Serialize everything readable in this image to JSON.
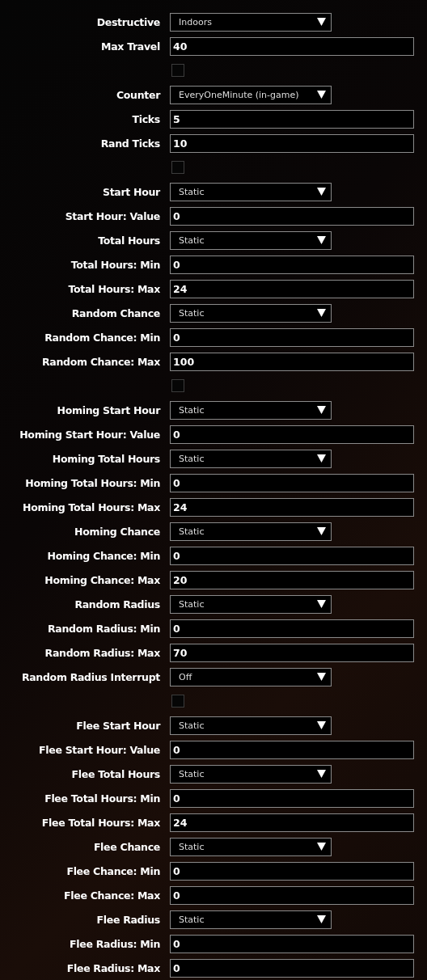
{
  "rows": [
    {
      "kind": "select",
      "label": "Destructive",
      "value": "Indoors"
    },
    {
      "kind": "input",
      "label": "Max Travel",
      "value": "40"
    },
    {
      "kind": "checkbox",
      "checked": false
    },
    {
      "kind": "select",
      "label": "Counter",
      "value": "EveryOneMinute (in-game)"
    },
    {
      "kind": "input",
      "label": "Ticks",
      "value": "5"
    },
    {
      "kind": "input",
      "label": "Rand Ticks",
      "value": "10"
    },
    {
      "kind": "checkbox",
      "checked": false
    },
    {
      "kind": "select",
      "label": "Start Hour",
      "value": "Static"
    },
    {
      "kind": "input",
      "label": "Start Hour: Value",
      "value": "0"
    },
    {
      "kind": "select",
      "label": "Total Hours",
      "value": "Static"
    },
    {
      "kind": "input",
      "label": "Total Hours: Min",
      "value": "0"
    },
    {
      "kind": "input",
      "label": "Total Hours: Max",
      "value": "24"
    },
    {
      "kind": "select",
      "label": "Random Chance",
      "value": "Static"
    },
    {
      "kind": "input",
      "label": "Random Chance: Min",
      "value": "0"
    },
    {
      "kind": "input",
      "label": "Random Chance: Max",
      "value": "100"
    },
    {
      "kind": "checkbox",
      "checked": false
    },
    {
      "kind": "select",
      "label": "Homing Start Hour",
      "value": "Static"
    },
    {
      "kind": "input",
      "label": "Homing Start Hour: Value",
      "value": "0"
    },
    {
      "kind": "select",
      "label": "Homing Total Hours",
      "value": "Static"
    },
    {
      "kind": "input",
      "label": "Homing Total Hours: Min",
      "value": "0"
    },
    {
      "kind": "input",
      "label": "Homing Total Hours: Max",
      "value": "24"
    },
    {
      "kind": "select",
      "label": "Homing Chance",
      "value": "Static"
    },
    {
      "kind": "input",
      "label": "Homing Chance: Min",
      "value": "0"
    },
    {
      "kind": "input",
      "label": "Homing Chance: Max",
      "value": "20"
    },
    {
      "kind": "select",
      "label": "Random Radius",
      "value": "Static"
    },
    {
      "kind": "input",
      "label": "Random Radius: Min",
      "value": "0"
    },
    {
      "kind": "input",
      "label": "Random Radius: Max",
      "value": "70"
    },
    {
      "kind": "select",
      "label": "Random Radius Interrupt",
      "value": "Off"
    },
    {
      "kind": "checkbox",
      "checked": false
    },
    {
      "kind": "select",
      "label": "Flee Start Hour",
      "value": "Static"
    },
    {
      "kind": "input",
      "label": "Flee Start Hour: Value",
      "value": "0"
    },
    {
      "kind": "select",
      "label": "Flee Total Hours",
      "value": "Static"
    },
    {
      "kind": "input",
      "label": "Flee Total Hours: Min",
      "value": "0"
    },
    {
      "kind": "input",
      "label": "Flee Total Hours: Max",
      "value": "24"
    },
    {
      "kind": "select",
      "label": "Flee Chance",
      "value": "Static"
    },
    {
      "kind": "input",
      "label": "Flee Chance: Min",
      "value": "0"
    },
    {
      "kind": "input",
      "label": "Flee Chance: Max",
      "value": "0"
    },
    {
      "kind": "select",
      "label": "Flee Radius",
      "value": "Static"
    },
    {
      "kind": "input",
      "label": "Flee Radius: Min",
      "value": "0"
    },
    {
      "kind": "input",
      "label": "Flee Radius: Max",
      "value": "0"
    }
  ]
}
